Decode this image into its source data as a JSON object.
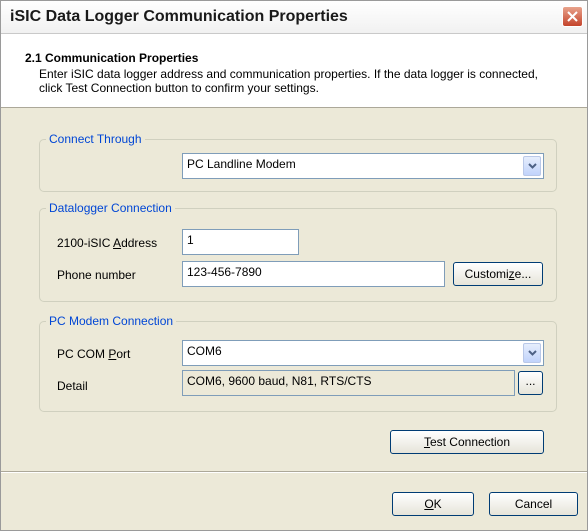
{
  "window": {
    "title": "iSIC Data Logger Communication Properties"
  },
  "header": {
    "title": "2.1 Communication Properties",
    "description": "Enter iSIC data logger address and communication properties. If the data logger is connected, click Test Connection button to confirm your settings."
  },
  "connect_through": {
    "legend": "Connect Through",
    "value": "PC Landline Modem"
  },
  "datalogger": {
    "legend": "Datalogger Connection",
    "address_label_pre": "2100-iSIC ",
    "address_label_acc": "A",
    "address_label_post": "ddress",
    "address_value": "1",
    "phone_label": "Phone number",
    "phone_value": "123-456-7890",
    "customize_pre": "Customi",
    "customize_acc": "z",
    "customize_post": "e..."
  },
  "modem": {
    "legend": "PC Modem Connection",
    "port_label_pre": "PC COM ",
    "port_label_acc": "P",
    "port_label_post": "ort",
    "port_value": "COM6",
    "detail_label": "Detail",
    "detail_value": "COM6, 9600 baud, N81, RTS/CTS",
    "ellipsis": "..."
  },
  "buttons": {
    "test_acc": "T",
    "test_post": "est Connection",
    "ok_acc": "O",
    "ok_post": "K",
    "cancel": "Cancel"
  },
  "colors": {
    "legend": "#0046d5",
    "dialog_bg": "#ece9d8",
    "close": "#c4442b"
  }
}
